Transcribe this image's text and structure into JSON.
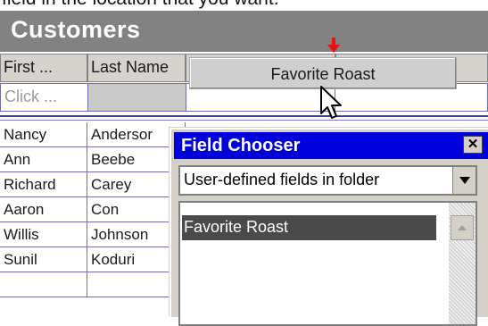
{
  "caption": "field in the location that you want.",
  "window": {
    "title": "Customers"
  },
  "columns": [
    "First ...",
    "Last Name",
    "",
    ""
  ],
  "dragged_header": "Favorite Roast",
  "new_row_placeholder": "Click ...",
  "rows": [
    {
      "first": "Nancy",
      "last": "Andersor"
    },
    {
      "first": "Ann",
      "last": "Beebe"
    },
    {
      "first": "Richard",
      "last": "Carey"
    },
    {
      "first": "Aaron",
      "last": "Con"
    },
    {
      "first": "Willis",
      "last": "Johnson"
    },
    {
      "first": "Sunil",
      "last": "Koduri"
    }
  ],
  "field_chooser": {
    "title": "Field Chooser",
    "close_glyph": "✕",
    "dropdown_value": "User-defined fields in folder",
    "items": [
      "Favorite Roast"
    ]
  },
  "colors": {
    "title_bar": "#828282",
    "chooser_title_bar": "#0000dd",
    "drop_marker": "#e81010",
    "selected_item": "#4a4a4a"
  },
  "icons": {
    "drop_marker": "red-arrow-icon",
    "pointer": "arrow-cursor-icon",
    "dropdown": "triangle-down-icon",
    "scroll_up": "triangle-up-icon"
  }
}
